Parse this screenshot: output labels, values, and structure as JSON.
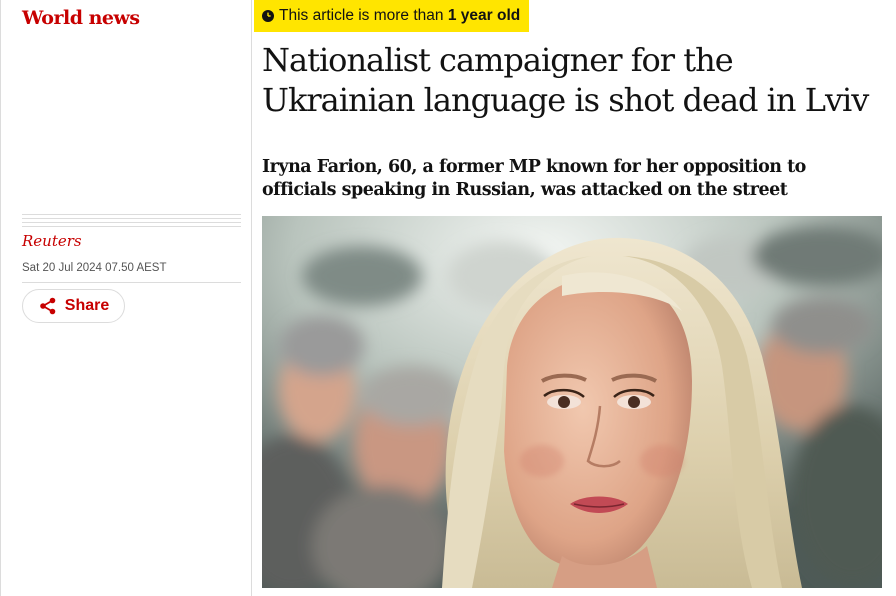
{
  "section": {
    "label": "World news"
  },
  "article_age_badge": {
    "prefix": "This article is more than",
    "emphasis": "1 year old",
    "icon": "clock-icon"
  },
  "headline": "Nationalist campaigner for the Ukrainian language is shot dead in Lviv",
  "standfirst": "Iryna Farion, 60, a former MP known for her opposition to officials speaking in Russian, was attacked on the street",
  "meta": {
    "byline": "Reuters",
    "dateline": "Sat 20 Jul 2024 07.50 AEST"
  },
  "share": {
    "label": "Share",
    "icon": "share-icon"
  },
  "colors": {
    "brand_red": "#c70000",
    "badge_yellow": "#ffe500",
    "text": "#121212",
    "rule": "#dcdcdc"
  }
}
